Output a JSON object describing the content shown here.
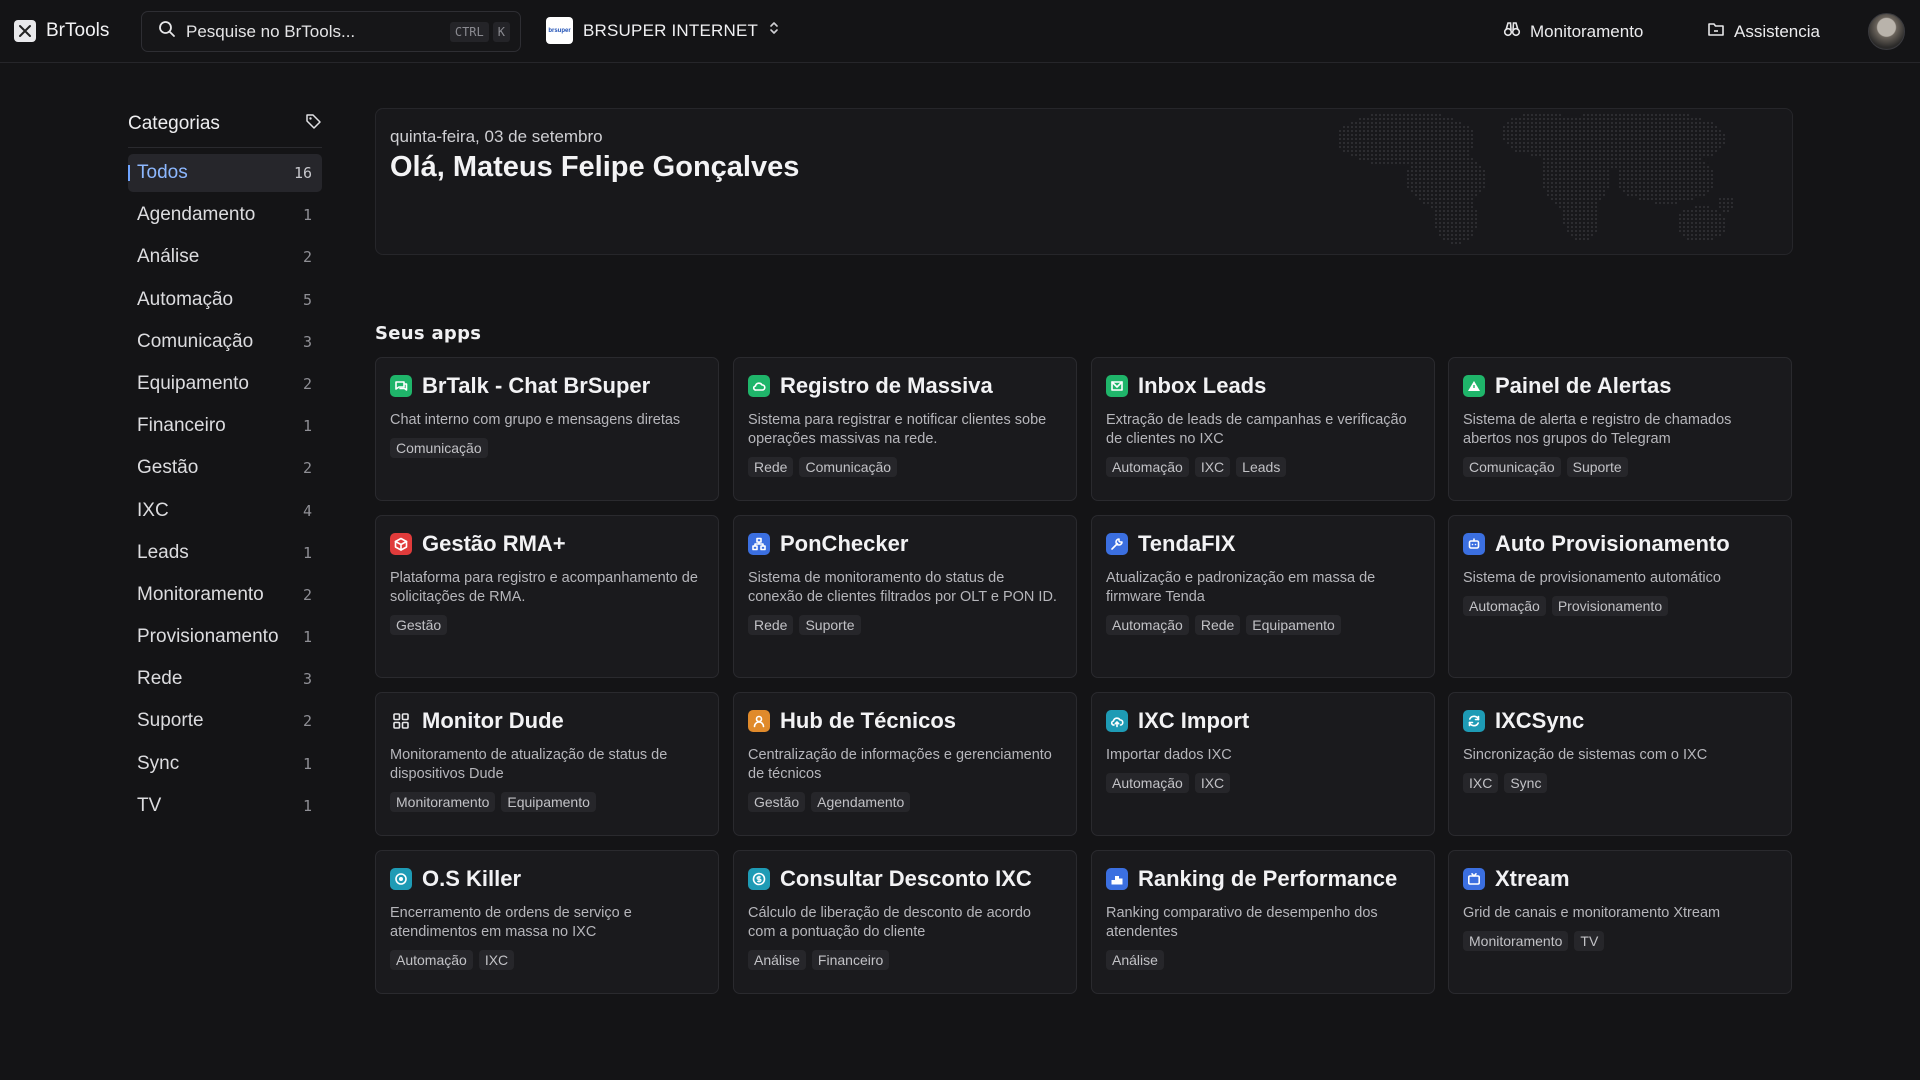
{
  "app": {
    "name": "BrTools"
  },
  "search": {
    "placeholder": "Pesquise no BrTools...",
    "shortcut": [
      "CTRL",
      "K"
    ]
  },
  "org": {
    "name": "BRSUPER INTERNET",
    "logo_text": "brsuper"
  },
  "nav": [
    {
      "label": "Monitoramento",
      "icon": "binoculars-icon"
    },
    {
      "label": "Assistencia",
      "icon": "folder-icon"
    }
  ],
  "sidebar": {
    "title": "Categorias",
    "items": [
      {
        "label": "Todos",
        "count": "16",
        "active": true
      },
      {
        "label": "Agendamento",
        "count": "1"
      },
      {
        "label": "Análise",
        "count": "2"
      },
      {
        "label": "Automação",
        "count": "5"
      },
      {
        "label": "Comunicação",
        "count": "3"
      },
      {
        "label": "Equipamento",
        "count": "2"
      },
      {
        "label": "Financeiro",
        "count": "1"
      },
      {
        "label": "Gestão",
        "count": "2"
      },
      {
        "label": "IXC",
        "count": "4"
      },
      {
        "label": "Leads",
        "count": "1"
      },
      {
        "label": "Monitoramento",
        "count": "2"
      },
      {
        "label": "Provisionamento",
        "count": "1"
      },
      {
        "label": "Rede",
        "count": "3"
      },
      {
        "label": "Suporte",
        "count": "2"
      },
      {
        "label": "Sync",
        "count": "1"
      },
      {
        "label": "TV",
        "count": "1"
      }
    ]
  },
  "hero": {
    "date": "quinta-feira, 03 de setembro",
    "greeting": "Olá, Mateus Felipe Gonçalves"
  },
  "apps_section": {
    "title": "Seus apps"
  },
  "apps": [
    {
      "title": "BrTalk - Chat BrSuper",
      "desc": "Chat interno com grupo e mensagens diretas",
      "tags": [
        "Comunicação"
      ],
      "icon": "chat-icon",
      "color": "#1fb56a"
    },
    {
      "title": "Registro de Massiva",
      "desc": "Sistema para registrar e notificar clientes sobe operações massivas na rede.",
      "tags": [
        "Rede",
        "Comunicação"
      ],
      "icon": "cloud-icon",
      "color": "#1fb56a"
    },
    {
      "title": "Inbox Leads",
      "desc": "Extração de leads de campanhas e verificação de clientes no IXC",
      "tags": [
        "Automação",
        "IXC",
        "Leads"
      ],
      "icon": "mail-icon",
      "color": "#1fb56a"
    },
    {
      "title": "Painel de Alertas",
      "desc": "Sistema de alerta e registro de chamados abertos nos grupos do Telegram",
      "tags": [
        "Comunicação",
        "Suporte"
      ],
      "icon": "alert-icon",
      "color": "#1fb56a"
    },
    {
      "title": "Gestão RMA+",
      "desc": "Plataforma para registro e acompanhamento de solicitações de RMA.",
      "tags": [
        "Gestão"
      ],
      "icon": "box-icon",
      "color": "#e03b3b"
    },
    {
      "title": "PonChecker",
      "desc": "Sistema de monitoramento do status de conexão de clientes filtrados por OLT e PON ID.",
      "tags": [
        "Rede",
        "Suporte"
      ],
      "icon": "network-icon",
      "color": "#3b6fe0"
    },
    {
      "title": "TendaFIX",
      "desc": "Atualização e padronização em massa de firmware Tenda",
      "tags": [
        "Automação",
        "Rede",
        "Equipamento"
      ],
      "icon": "wrench-icon",
      "color": "#3b6fe0"
    },
    {
      "title": "Auto Provisionamento",
      "desc": "Sistema de provisionamento automático",
      "tags": [
        "Automação",
        "Provisionamento"
      ],
      "icon": "bot-icon",
      "color": "#3b6fe0"
    },
    {
      "title": "Monitor Dude",
      "desc": "Monitoramento de atualização de status de dispositivos Dude",
      "tags": [
        "Monitoramento",
        "Equipamento"
      ],
      "icon": "grid-icon",
      "color": "#1a1a1d"
    },
    {
      "title": "Hub de Técnicos",
      "desc": "Centralização de informações e gerenciamento de técnicos",
      "tags": [
        "Gestão",
        "Agendamento"
      ],
      "icon": "technician-icon",
      "color": "#e08a2b"
    },
    {
      "title": "IXC Import",
      "desc": "Importar dados IXC",
      "tags": [
        "Automação",
        "IXC"
      ],
      "icon": "cloud-upload-icon",
      "color": "#1e9bb5"
    },
    {
      "title": "IXCSync",
      "desc": "Sincronização de sistemas com o IXC",
      "tags": [
        "IXC",
        "Sync"
      ],
      "icon": "sync-icon",
      "color": "#1e9bb5"
    },
    {
      "title": "O.S Killer",
      "desc": "Encerramento de ordens de serviço e atendimentos em massa no IXC",
      "tags": [
        "Automação",
        "IXC"
      ],
      "icon": "target-icon",
      "color": "#1e9bb5"
    },
    {
      "title": "Consultar Desconto IXC",
      "desc": "Cálculo de liberação de desconto de acordo com a pontuação do cliente",
      "tags": [
        "Análise",
        "Financeiro"
      ],
      "icon": "dollar-icon",
      "color": "#1e9bb5"
    },
    {
      "title": "Ranking de Performance",
      "desc": "Ranking comparativo de desempenho dos atendentes",
      "tags": [
        "Análise"
      ],
      "icon": "podium-icon",
      "color": "#3b6fe0"
    },
    {
      "title": "Xtream",
      "desc": "Grid de canais e monitoramento Xtream",
      "tags": [
        "Monitoramento",
        "TV"
      ],
      "icon": "tv-icon",
      "color": "#3b6fe0"
    }
  ]
}
